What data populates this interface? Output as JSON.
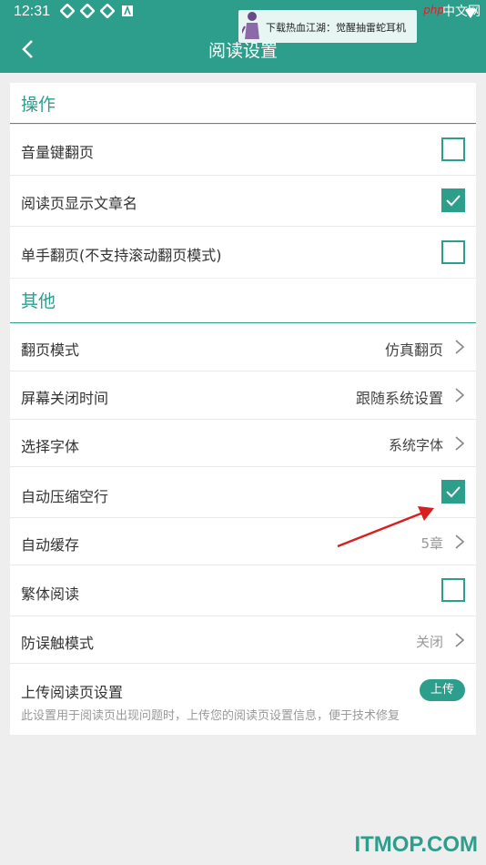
{
  "status_bar": {
    "time": "12:31",
    "icons": [
      "notification-icon",
      "notification-icon",
      "notification-icon",
      "app-icon"
    ]
  },
  "app_bar": {
    "title": "阅读设置",
    "back_icon": "back-arrow-icon"
  },
  "ad_banner": {
    "text": "下载热血江湖：觉醒抽雷蛇耳机"
  },
  "site_logo": {
    "php": "php",
    "cn": "中文网"
  },
  "sections": {
    "operation": {
      "title": "操作"
    },
    "other": {
      "title": "其他"
    }
  },
  "settings": {
    "volume_key_page": {
      "label": "音量键翻页",
      "checked": false
    },
    "show_chapter_name": {
      "label": "阅读页显示文章名",
      "checked": true
    },
    "one_hand_page": {
      "label": "单手翻页(不支持滚动翻页模式)",
      "checked": false
    },
    "page_mode": {
      "label": "翻页模式",
      "value": "仿真翻页"
    },
    "screen_off": {
      "label": "屏幕关闭时间",
      "value": "跟随系统设置"
    },
    "font": {
      "label": "选择字体",
      "value": "系统字体"
    },
    "compress_blank": {
      "label": "自动压缩空行",
      "checked": true
    },
    "auto_cache": {
      "label": "自动缓存",
      "value": "5章"
    },
    "traditional": {
      "label": "繁体阅读",
      "checked": false
    },
    "anti_touch": {
      "label": "防误触模式",
      "value": "关闭"
    },
    "upload": {
      "label": "上传阅读页设置",
      "button": "上传",
      "desc": "此设置用于阅读页出现问题时，上传您的阅读页设置信息，便于技术修复"
    }
  },
  "watermark": "ITMOP.COM",
  "colors": {
    "accent": "#2e9e8c",
    "annotation_arrow": "#d62020"
  }
}
